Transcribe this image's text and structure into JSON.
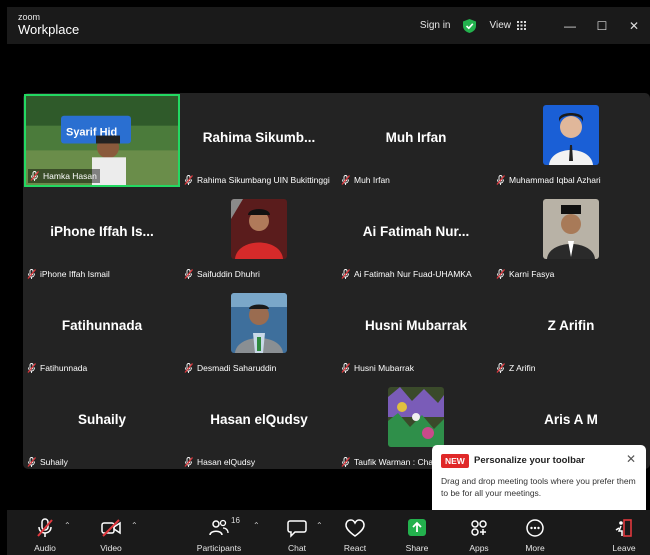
{
  "app": {
    "brand_small": "zoom",
    "brand_big": "Workplace"
  },
  "titlebar": {
    "sign_in": "Sign in",
    "view": "View"
  },
  "participants_grid": [
    {
      "name": "Hamka Hasan",
      "display": "",
      "type": "video",
      "label": "Hamka Hasan"
    },
    {
      "name": "Rahima Sikumbang UIN Bukittinggi",
      "display": "Rahima Sikumb...",
      "type": "name",
      "label": "Rahima Sikumbang UIN Bukittinggi"
    },
    {
      "name": "Muh Irfan",
      "display": "Muh Irfan",
      "type": "name",
      "label": "Muh Irfan"
    },
    {
      "name": "Muhammad Iqbal Azhari",
      "display": "",
      "type": "avatar",
      "label": "Muhammad Iqbal Azhari"
    },
    {
      "name": "iPhone Iffah Ismail",
      "display": "iPhone Iffah Is...",
      "type": "name",
      "label": "iPhone Iffah Ismail"
    },
    {
      "name": "Saifuddin Dhuhri",
      "display": "",
      "type": "avatar",
      "label": "Saifuddin Dhuhri"
    },
    {
      "name": "Ai Fatimah Nur Fuad-UHAMKA",
      "display": "Ai Fatimah Nur...",
      "type": "name",
      "label": "Ai Fatimah Nur Fuad-UHAMKA"
    },
    {
      "name": "Karni Fasya",
      "display": "",
      "type": "avatar",
      "label": "Karni Fasya"
    },
    {
      "name": "Fatihunnada",
      "display": "Fatihunnada",
      "type": "name",
      "label": "Fatihunnada"
    },
    {
      "name": "Desmadi Saharuddin",
      "display": "",
      "type": "avatar",
      "label": "Desmadi Saharuddin"
    },
    {
      "name": "Husni Mubarrak",
      "display": "Husni Mubarrak",
      "type": "name",
      "label": "Husni Mubarrak"
    },
    {
      "name": "Z Arifin",
      "display": "Z Arifin",
      "type": "name",
      "label": "Z Arifin"
    },
    {
      "name": "Suhaily",
      "display": "Suhaily",
      "type": "name",
      "label": "Suhaily"
    },
    {
      "name": "Hasan elQudsy",
      "display": "Hasan elQudsy",
      "type": "name",
      "label": "Hasan elQudsy"
    },
    {
      "name": "Taufik Warman : Chan",
      "display": "",
      "type": "avatar",
      "label": "Taufik Warman : Chan"
    },
    {
      "name": "Aris A M",
      "display": "Aris A M",
      "type": "name",
      "label": ""
    }
  ],
  "popover": {
    "badge": "NEW",
    "title": "Personalize your toolbar",
    "body": "Drag and drop meeting tools where you prefer them to be for all your meetings."
  },
  "toolbar": {
    "audio": "Audio",
    "video": "Video",
    "participants": "Participants",
    "participants_count": "16",
    "chat": "Chat",
    "react": "React",
    "share": "Share",
    "apps": "Apps",
    "more": "More",
    "leave": "Leave"
  },
  "colors": {
    "active_speaker": "#23d962",
    "share_green": "#23b14d",
    "muted_red": "#e0383e",
    "new_badge": "#e02828"
  }
}
